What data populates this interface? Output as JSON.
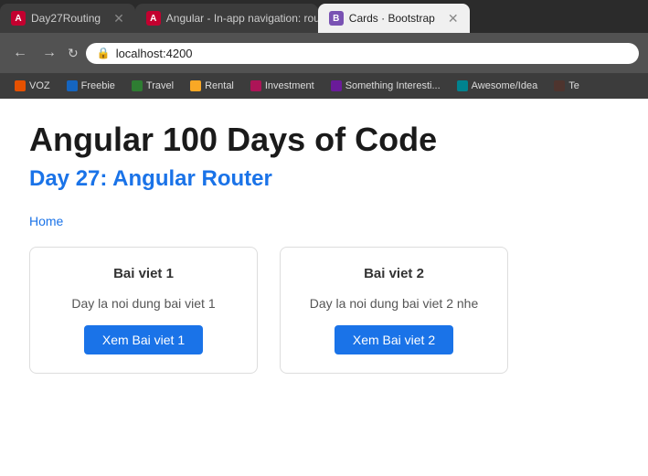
{
  "browser": {
    "tabs": [
      {
        "id": "tab1",
        "icon_label": "A",
        "icon_color": "angular",
        "label": "Day27Routing",
        "active": false
      },
      {
        "id": "tab2",
        "icon_label": "A",
        "icon_color": "angular",
        "label": "Angular - In-app navigation: rou...",
        "active": false
      },
      {
        "id": "tab3",
        "icon_label": "B",
        "icon_color": "bootstrap",
        "label": "Cards · Bootstrap",
        "active": true
      }
    ],
    "address": "localhost:4200",
    "bookmarks": [
      {
        "label": "VOZ",
        "color": "#e65100"
      },
      {
        "label": "Freebie",
        "color": "#1565c0"
      },
      {
        "label": "Travel",
        "color": "#2e7d32"
      },
      {
        "label": "Rental",
        "color": "#f9a825"
      },
      {
        "label": "Investment",
        "color": "#ad1457"
      },
      {
        "label": "Something Interesti...",
        "color": "#6a1b9a"
      },
      {
        "label": "Awesome/Idea",
        "color": "#00838f"
      },
      {
        "label": "Te",
        "color": "#4e342e"
      }
    ]
  },
  "page": {
    "title": "Angular 100 Days of Code",
    "subtitle": "Day 27: Angular Router",
    "nav_link": "Home",
    "cards": [
      {
        "title": "Bai viet 1",
        "content": "Day la noi dung bai viet 1",
        "button_label": "Xem Bai viet 1"
      },
      {
        "title": "Bai viet 2",
        "content": "Day la noi dung bai viet 2 nhe",
        "button_label": "Xem Bai viet 2"
      }
    ]
  }
}
